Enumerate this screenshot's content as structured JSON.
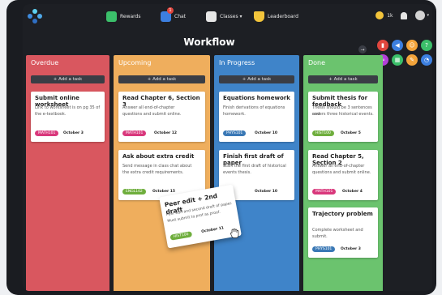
{
  "topbar": {
    "nav": [
      {
        "label": "Rewards",
        "icon": "gift-icon"
      },
      {
        "label": "Chat",
        "icon": "chat-icon",
        "badge": "1"
      },
      {
        "label": "Classes ▾",
        "icon": "building-icon"
      },
      {
        "label": "Leaderboard",
        "icon": "trophy-icon"
      }
    ],
    "coins": "1k"
  },
  "page": {
    "title": "Workflow"
  },
  "board": {
    "add_task_label": "+ Add a task",
    "columns": [
      {
        "name": "Overdue",
        "color": "#d9575f"
      },
      {
        "name": "Upcoming",
        "color": "#efae5d"
      },
      {
        "name": "In Progress",
        "color": "#3f84c9"
      },
      {
        "name": "Done",
        "color": "#6bc36e"
      }
    ],
    "cards": {
      "c1": {
        "title": "Submit online worksheet",
        "desc1": "Link to worksheet is on pg 35 of",
        "desc2": "the e-textbook.",
        "tag": "MATH101",
        "date": "October 3"
      },
      "c2": {
        "title": "Read Chapter 6, Section 3",
        "desc1": "Answer all end-of-chapter",
        "desc2": "questions and submit online.",
        "tag": "MATH101",
        "date": "October 12"
      },
      "c3": {
        "title": "Ask about extra credit",
        "desc1": "Send message in class chat about",
        "desc2": "the extra credit requirements.",
        "tag": "ENGL102",
        "date": "October 15"
      },
      "c4": {
        "title": "Equations homework",
        "desc1": "Finish derivations of equations",
        "desc2": "homework.",
        "tag": "PHYS101",
        "date": "October 10"
      },
      "c5": {
        "title": "Finish first draft of paper",
        "desc1": "Start the first draft of historical",
        "desc2": "events thesis.",
        "tag": "",
        "date": "October 10"
      },
      "c6": {
        "title": "Submit thesis for feedback",
        "desc1": "Thesis should be 3 sentences and",
        "desc2": "covers three historical events.",
        "tag": "HIST100",
        "date": "October 5"
      },
      "c7": {
        "title": "Read Chapter 5, Section 2",
        "desc1": "Answer all end-of-chapter",
        "desc2": "questions and submit online.",
        "tag": "MATH101",
        "date": "October 4"
      },
      "c8": {
        "title": "Trajectory problem",
        "desc1": "Complete worksheet and submit.",
        "tag": "PHYS101",
        "date": "October 3"
      },
      "drag": {
        "title": "Peer edit + 2nd draft",
        "desc1": "Peer edit and second draft of paper.",
        "desc2": "Must submit to prof as proof.",
        "tag": "HIST100",
        "date": "October 11"
      }
    }
  },
  "tools": [
    {
      "icon": "book-icon",
      "color": "#e0463e"
    },
    {
      "icon": "megaphone-icon",
      "color": "#3c7fe0"
    },
    {
      "icon": "emoji-icon",
      "color": "#f3a43b"
    },
    {
      "icon": "help-icon",
      "color": "#3bbf6a"
    },
    {
      "icon": "link-icon",
      "color": "#b440d9"
    },
    {
      "icon": "calculator-icon",
      "color": "#3bbf6a"
    },
    {
      "icon": "pencil-icon",
      "color": "#f3a43b"
    },
    {
      "icon": "chat-bubble-icon",
      "color": "#3c7fe0"
    }
  ]
}
